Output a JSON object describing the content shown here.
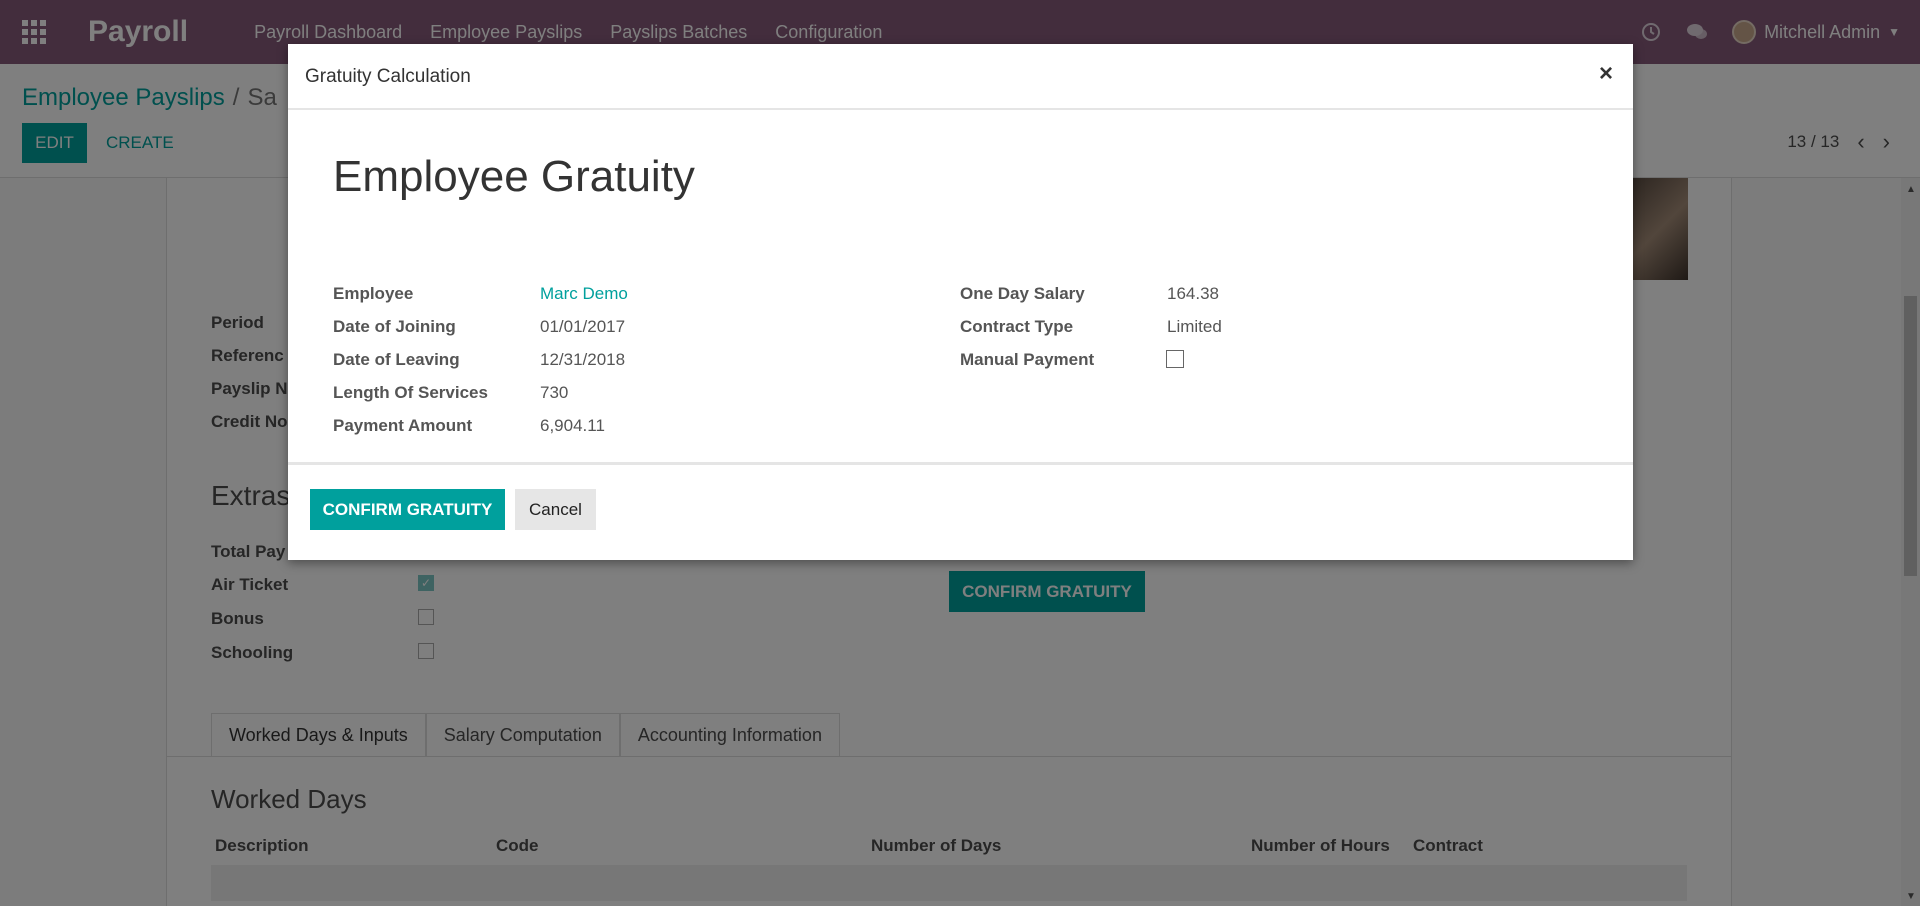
{
  "navbar": {
    "app_name": "Payroll",
    "menu": [
      "Payroll Dashboard",
      "Employee Payslips",
      "Payslips Batches",
      "Configuration"
    ],
    "user_name": "Mitchell Admin"
  },
  "control_panel": {
    "breadcrumb_link": "Employee Payslips",
    "breadcrumb_sep": "/",
    "breadcrumb_current": "Sa",
    "edit_label": "EDIT",
    "create_label": "CREATE",
    "pager_text": "13 / 13"
  },
  "background_form": {
    "labels": [
      "Period",
      "Referenc",
      "Payslip N",
      "Credit No"
    ],
    "extras_title": "Extras",
    "extras_labels": [
      "Total Pay",
      "Air Ticket",
      "Bonus",
      "Schooling"
    ],
    "air_ticket_checked": true,
    "bonus_checked": false,
    "schooling_checked": false,
    "confirm_button": "CONFIRM GRATUITY",
    "tabs": [
      "Worked Days & Inputs",
      "Salary Computation",
      "Accounting Information"
    ],
    "worked_days_title": "Worked Days",
    "table_headers": [
      "Description",
      "Code",
      "Number of Days",
      "Number of Hours",
      "Contract"
    ]
  },
  "modal": {
    "title": "Gratuity Calculation",
    "close_glyph": "×",
    "form_title": "Employee Gratuity",
    "left_fields": [
      {
        "label": "Employee",
        "value": "Marc Demo"
      },
      {
        "label": "Date of Joining",
        "value": "01/01/2017"
      },
      {
        "label": "Date of Leaving",
        "value": "12/31/2018"
      },
      {
        "label": "Length Of Services",
        "value": "730"
      },
      {
        "label": "Payment Amount",
        "value": "6,904.11"
      }
    ],
    "right_fields": [
      {
        "label": "One Day Salary",
        "value": "164.38"
      },
      {
        "label": "Contract Type",
        "value": "Limited"
      },
      {
        "label": "Manual Payment",
        "value": ""
      }
    ],
    "manual_payment_checked": false,
    "confirm_label": "CONFIRM GRATUITY",
    "cancel_label": "Cancel"
  },
  "icons": {
    "apps": "apps-grid-icon",
    "clock": "clock-icon",
    "chat": "chat-icon",
    "prev": "chevron-left-icon",
    "next": "chevron-right-icon"
  },
  "colors": {
    "navbar": "#875a7b",
    "primary": "#00a09d",
    "overlay": "rgba(0,0,0,0.5)"
  }
}
